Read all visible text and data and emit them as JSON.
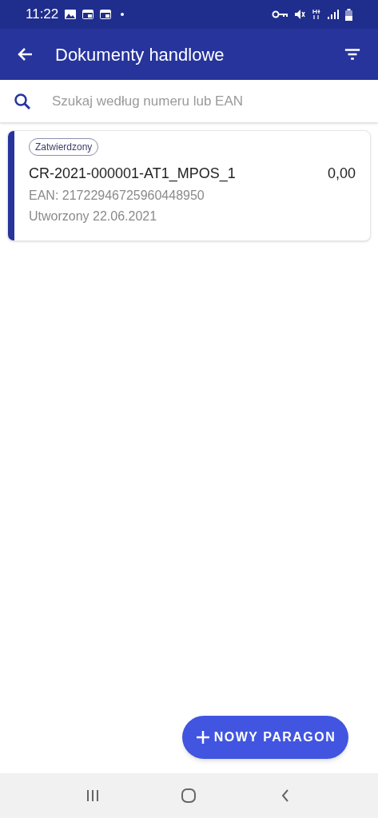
{
  "status_bar": {
    "time": "11:22"
  },
  "app_bar": {
    "title": "Dokumenty handlowe"
  },
  "search": {
    "placeholder": "Szukaj według numeru lub EAN"
  },
  "documents": [
    {
      "status": "Zatwierdzony",
      "number": "CR-2021-000001-AT1_MPOS_1",
      "amount": "0,00",
      "ean": "EAN: 21722946725960448950",
      "created": "Utworzony 22.06.2021",
      "color": "#26349c"
    }
  ],
  "fab": {
    "label": "NOWY PARAGON"
  }
}
